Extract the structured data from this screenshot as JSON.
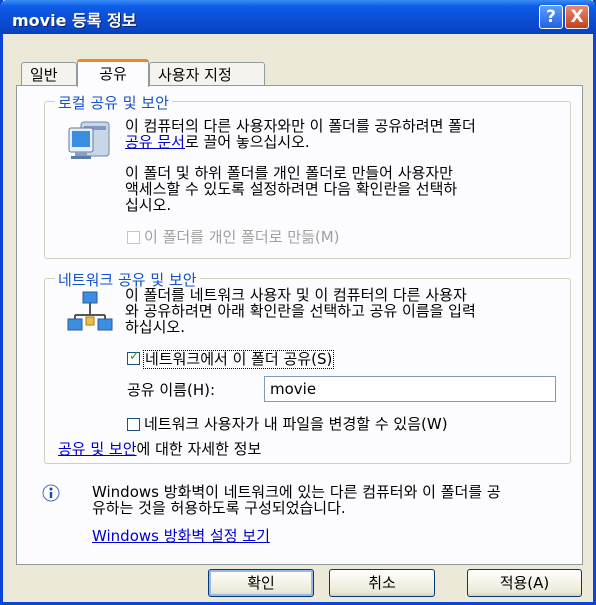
{
  "window": {
    "title": "movie 등록 정보"
  },
  "titlebar": {
    "help": "?",
    "close": "X"
  },
  "tabs": [
    {
      "label": "일반"
    },
    {
      "label": "공유"
    },
    {
      "label": "사용자 지정"
    }
  ],
  "local": {
    "legend": "로컬 공유 및 보안",
    "p1_line1": "이 컴퓨터의 다른 사용자와만 이 폴더를 공유하려면 폴더",
    "p1_line2_link": "공유 문서",
    "p1_line2_rest": "로 끌어 놓으십시오.",
    "p2_line1": "이 폴더 및 하위 폴더를 개인 폴더로 만들어 사용자만",
    "p2_line2": "액세스할 수 있도록 설정하려면 다음 확인란을 선택하",
    "p2_line3": "십시오.",
    "private_checkbox": "이 폴더를 개인 폴더로 만듦(M)",
    "private_checked": false
  },
  "network": {
    "legend": "네트워크 공유 및 보안",
    "p_line1": "이 폴더를 네트워크 사용자 및 이 컴퓨터의 다른 사용자",
    "p_line2": "와 공유하려면 아래 확인란을 선택하고 공유 이름을 입력",
    "p_line3": "하십시오.",
    "share_checkbox": "네트워크에서 이 폴더 공유(S)",
    "share_checked": true,
    "share_name_label": "공유 이름(H):",
    "share_name_value": "movie",
    "allow_change_checkbox": "네트워크 사용자가 내 파일을 변경할 수 있음(W)",
    "allow_change_checked": false,
    "more_info_link": "공유 및 보안",
    "more_info_rest": "에 대한 자세한 정보"
  },
  "firewall": {
    "line1": "Windows 방화벽이 네트워크에 있는 다른 컴퓨터와 이 폴더를 공",
    "line2": "유하는 것을 허용하도록 구성되었습니다.",
    "link": "Windows 방화벽 설정 보기"
  },
  "buttons": {
    "ok": "확인",
    "cancel": "취소",
    "apply": "적용(A)"
  },
  "colors": {
    "titlebar": "#0a4ed6",
    "link": "#0000cc",
    "legend": "#1450c8",
    "tab_accent": "#e68b2c"
  }
}
